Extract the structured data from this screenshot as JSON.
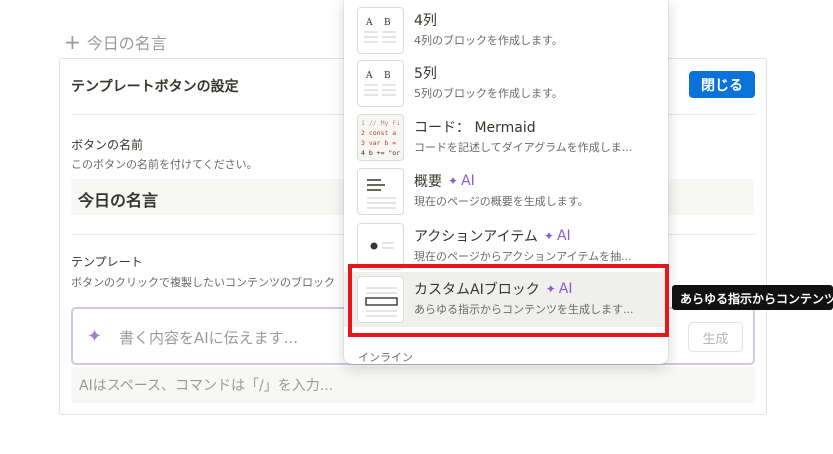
{
  "background_heading": {
    "plus": "+",
    "text": "今日の名言"
  },
  "panel": {
    "title": "テンプレートボタンの設定",
    "close_label": "閉じる",
    "button_name_label": "ボタンの名前",
    "button_name_help": "このボタンの名前を付けてください。",
    "button_name_value": "今日の名言",
    "template_label": "テンプレート",
    "template_help": "ボタンのクリックで複製したいコンテンツのブロック",
    "ai_input_placeholder": "書く内容をAIに伝えます...",
    "generate_label": "生成",
    "editor_placeholder": "AIはスペース、コマンドは「/」を入力..."
  },
  "menu": {
    "items": [
      {
        "title": "4列",
        "desc": "4列のブロックを作成します。",
        "ai": false
      },
      {
        "title": "5列",
        "desc": "5列のブロックを作成します。",
        "ai": false
      },
      {
        "title": "コード： Mermaid",
        "desc": "コードを記述してダイアグラムを作成しま...",
        "ai": false
      },
      {
        "title": "概要",
        "desc": "現在のページの概要を生成します。",
        "ai": true
      },
      {
        "title": "アクションアイテム",
        "desc": "現在のページからアクションアイテムを抽...",
        "ai": true
      },
      {
        "title": "カスタムAIブロック",
        "desc": "あらゆる指示からコンテンツを生成します...",
        "ai": true
      }
    ],
    "ai_label": "AI",
    "thumb_letters": [
      "A",
      "B"
    ],
    "code_lines": [
      "1 // My Fi",
      "2 const a",
      "3 var b =",
      "4 b += \"or"
    ],
    "section_label": "インライン"
  },
  "tooltip": "あらゆる指示からコンテンツを生成します。",
  "colors": {
    "accent_blue": "#0b72d9",
    "ai_purple": "#8f5bd2",
    "highlight_red": "#e8151b",
    "selected_bg": "#efefed"
  }
}
